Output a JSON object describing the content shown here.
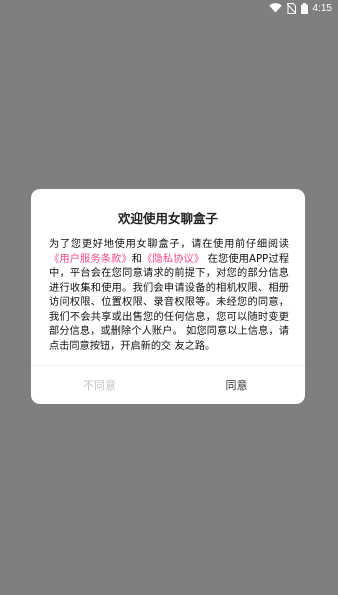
{
  "status_bar": {
    "time": "4:15",
    "icons": [
      "wifi-icon",
      "no-sim-icon",
      "battery-icon"
    ]
  },
  "dialog": {
    "title": "欢迎使用女聊盒子",
    "body": {
      "part1": "为了您更好地使用女聊盒子，请在使用前仔细阅读",
      "link1": "《用户服务条款》",
      "and": "和",
      "link2": "《隐私协议》",
      "part2": "在您使用APP过程中，平台会在您同意请求的前提下，对您的部分信息进行收集和使用。我们会申请设备的相机权限、相册访问权限、位置权限、录音权限等。未经您的同意，我们不会共享或出售您的任何信息，您可以随时变更部分信息，或删除个人账户。 如您同意以上信息，请点击同意按钮，开启新的交 友之路。"
    },
    "disagree_label": "不同意",
    "agree_label": "同意"
  },
  "colors": {
    "link": "#f24a8c",
    "overlay": "#7f7f7f",
    "disabled_text": "#c4c4c4"
  }
}
